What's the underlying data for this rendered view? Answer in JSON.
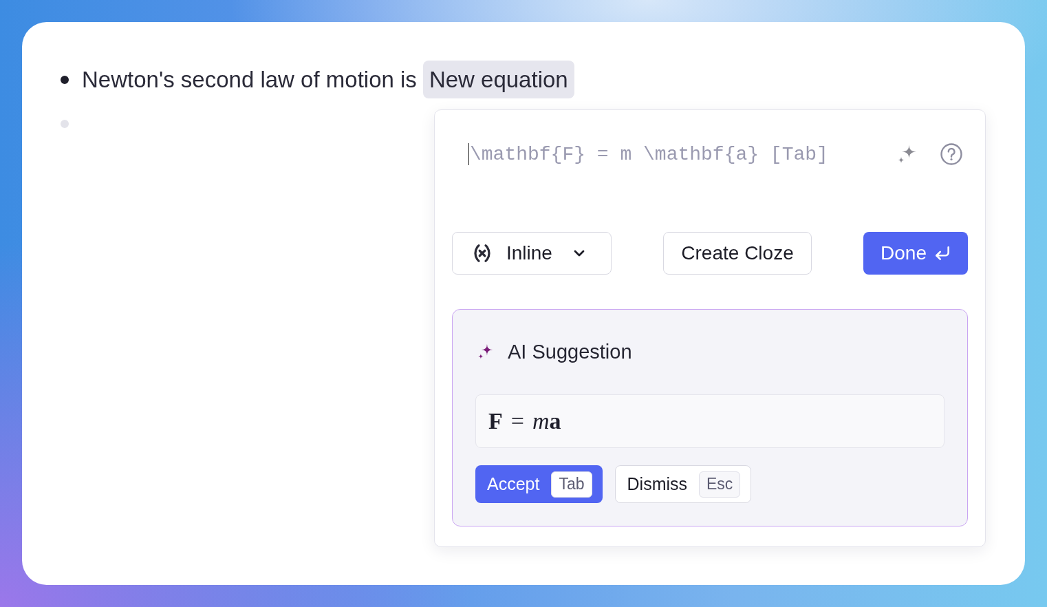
{
  "bullets": [
    {
      "kind": "text",
      "text": "Newton's second law of motion is",
      "equation_chip": "New equation"
    },
    {
      "kind": "empty"
    }
  ],
  "equation_editor": {
    "input": {
      "placeholder": "\\mathbf{F} = m \\mathbf{a} [Tab]"
    },
    "display_mode": {
      "label": "Inline"
    },
    "buttons": [
      {
        "kind": "secondary",
        "label": "Create Cloze"
      },
      {
        "kind": "primary",
        "label": "Done"
      }
    ],
    "ai_suggestion": {
      "title": "AI Suggestion",
      "equation": {
        "parts": [
          {
            "kind": "bold",
            "text": "F"
          },
          {
            "kind": "operator",
            "text": "="
          },
          {
            "kind": "italic",
            "text": "m"
          },
          {
            "kind": "bold",
            "text": "a"
          }
        ]
      },
      "actions": [
        {
          "kind": "primary",
          "label": "Accept",
          "shortcut": "Tab"
        },
        {
          "kind": "secondary",
          "label": "Dismiss",
          "shortcut": "Esc"
        }
      ]
    }
  }
}
